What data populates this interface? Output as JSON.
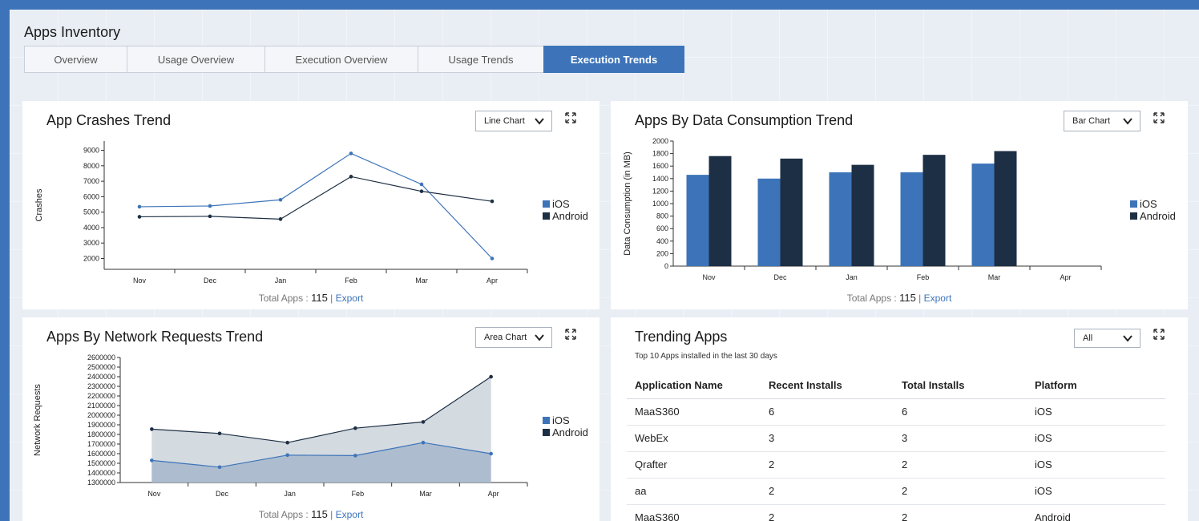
{
  "app_title": "Apps Inventory",
  "tabs": [
    "Overview",
    "Usage Overview",
    "Execution Overview",
    "Usage Trends",
    "Execution Trends"
  ],
  "active_tab": "Execution Trends",
  "footer": {
    "prefix": "Total Apps : ",
    "count": "115",
    "sep": " | ",
    "export_label": "Export"
  },
  "legend": {
    "ios": "iOS",
    "android": "Android",
    "ios_color": "#3d74b9",
    "android_color": "#1d2f44"
  },
  "crashes": {
    "title": "App Crashes Trend",
    "dropdown": "Line Chart",
    "ylabel": "Crashes",
    "chart_data": {
      "type": "line",
      "categories": [
        "Nov",
        "Dec",
        "Jan",
        "Feb",
        "Mar",
        "Apr"
      ],
      "series": [
        {
          "name": "iOS",
          "values": [
            5350,
            5400,
            5800,
            8800,
            6800,
            2000
          ]
        },
        {
          "name": "Android",
          "values": [
            4700,
            4730,
            4550,
            7300,
            6350,
            5700
          ]
        }
      ],
      "yticks": [
        2000,
        3000,
        4000,
        5000,
        6000,
        7000,
        8000,
        9000
      ],
      "ylim": [
        1300,
        9600
      ],
      "xlabel": "",
      "ylabel": "Crashes"
    }
  },
  "data": {
    "title": "Apps By Data Consumption Trend",
    "dropdown": "Bar Chart",
    "ylabel": "Data Consumption (in MB)",
    "chart_data": {
      "type": "bar",
      "categories": [
        "Nov",
        "Dec",
        "Jan",
        "Feb",
        "Mar",
        "Apr"
      ],
      "series": [
        {
          "name": "iOS",
          "values": [
            1460,
            1400,
            1500,
            1500,
            1640,
            0
          ]
        },
        {
          "name": "Android",
          "values": [
            1760,
            1720,
            1620,
            1780,
            1840,
            0
          ]
        }
      ],
      "yticks": [
        0,
        200,
        400,
        600,
        800,
        1000,
        1200,
        1400,
        1600,
        1800,
        2000
      ],
      "ylim": [
        0,
        2000
      ],
      "xlabel": "",
      "ylabel": "Data Consumption (in MB)"
    }
  },
  "network": {
    "title": "Apps By Network Requests Trend",
    "dropdown": "Area Chart",
    "ylabel": "Network Requests",
    "chart_data": {
      "type": "area",
      "categories": [
        "Nov",
        "Dec",
        "Jan",
        "Feb",
        "Mar",
        "Apr"
      ],
      "series": [
        {
          "name": "iOS",
          "values": [
            1530000,
            1460000,
            1585000,
            1580000,
            1715000,
            1600000
          ]
        },
        {
          "name": "Android",
          "values": [
            1855000,
            1810000,
            1715000,
            1865000,
            1930000,
            2400000
          ]
        }
      ],
      "yticks": [
        1300000,
        1400000,
        1500000,
        1600000,
        1700000,
        1800000,
        1900000,
        2000000,
        2100000,
        2200000,
        2300000,
        2400000,
        2500000,
        2600000
      ],
      "ylim": [
        1300000,
        2600000
      ],
      "xlabel": "",
      "ylabel": "Network Requests"
    }
  },
  "trending": {
    "title": "Trending Apps",
    "dropdown": "All",
    "subtitle": "Top 10 Apps installed in the last 30 days",
    "headers": [
      "Application Name",
      "Recent Installs",
      "Total Installs",
      "Platform"
    ],
    "rows": [
      [
        "MaaS360",
        "6",
        "6",
        "iOS"
      ],
      [
        "WebEx",
        "3",
        "3",
        "iOS"
      ],
      [
        "Qrafter",
        "2",
        "2",
        "iOS"
      ],
      [
        "aa",
        "2",
        "2",
        "iOS"
      ],
      [
        "MaaS360",
        "2",
        "2",
        "Android"
      ]
    ]
  }
}
